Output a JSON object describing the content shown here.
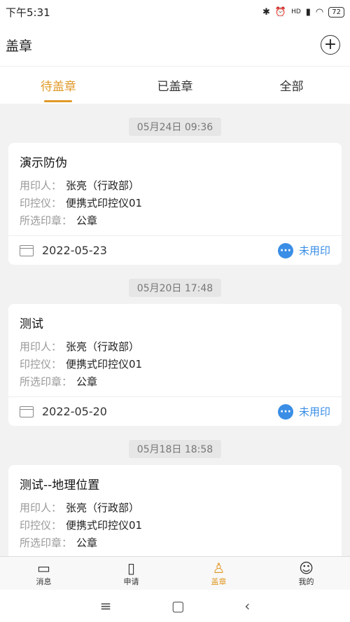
{
  "status_bar": {
    "time": "下午5:31",
    "battery": "72",
    "network": "HD"
  },
  "header": {
    "title": "盖章"
  },
  "tabs": [
    {
      "label": "待盖章"
    },
    {
      "label": "已盖章"
    },
    {
      "label": "全部"
    }
  ],
  "records": [
    {
      "timestamp": "05月24日 09:36",
      "title": "演示防伪",
      "user_label": "用印人：",
      "user": "张亮（行政部）",
      "device_label": "印控仪：",
      "device": "便携式印控仪01",
      "seal_label": "所选印章：",
      "seal": "公章",
      "date": "2022-05-23",
      "status": "未用印"
    },
    {
      "timestamp": "05月20日 17:48",
      "title": "测试",
      "user_label": "用印人：",
      "user": "张亮（行政部）",
      "device_label": "印控仪：",
      "device": "便携式印控仪01",
      "seal_label": "所选印章：",
      "seal": "公章",
      "date": "2022-05-20",
      "status": "未用印"
    },
    {
      "timestamp": "05月18日 18:58",
      "title": "测试--地理位置",
      "user_label": "用印人：",
      "user": "张亮（行政部）",
      "device_label": "印控仪：",
      "device": "便携式印控仪01",
      "seal_label": "所选印章：",
      "seal": "公章",
      "date": "",
      "status": ""
    }
  ],
  "bottom_nav": [
    {
      "label": "消息",
      "icon": "message-icon"
    },
    {
      "label": "申请",
      "icon": "apply-icon"
    },
    {
      "label": "盖章",
      "icon": "stamp-icon"
    },
    {
      "label": "我的",
      "icon": "profile-icon"
    }
  ],
  "colors": {
    "accent": "#e09a2a",
    "status_blue": "#3a8ee6"
  }
}
